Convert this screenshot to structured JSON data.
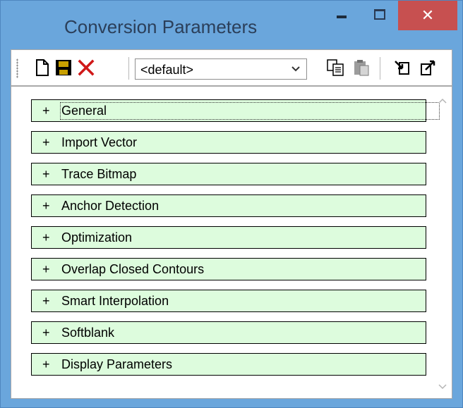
{
  "window": {
    "title": "Conversion Parameters",
    "minimize_icon": "minimize-icon",
    "maximize_icon": "maximize-icon",
    "close_label": "✕",
    "close_color": "#c75050"
  },
  "toolbar": {
    "buttons": [
      {
        "name": "new-icon"
      },
      {
        "name": "save-icon"
      },
      {
        "name": "delete-icon",
        "color": "#d01818"
      }
    ],
    "preset": {
      "value": "<default>"
    },
    "right_buttons": [
      {
        "name": "copy-icon"
      },
      {
        "name": "paste-icon"
      },
      {
        "name": "import-icon"
      },
      {
        "name": "export-icon"
      }
    ]
  },
  "sections": [
    {
      "plus": "+",
      "label": "General"
    },
    {
      "plus": "+",
      "label": "Import Vector"
    },
    {
      "plus": "+",
      "label": "Trace Bitmap"
    },
    {
      "plus": "+",
      "label": "Anchor Detection"
    },
    {
      "plus": "+",
      "label": "Optimization"
    },
    {
      "plus": "+",
      "label": "Overlap Closed Contours"
    },
    {
      "plus": "+",
      "label": "Smart Interpolation"
    },
    {
      "plus": "+",
      "label": "Softblank"
    },
    {
      "plus": "+",
      "label": "Display Parameters"
    }
  ],
  "colors": {
    "window_frame": "#6aa6dc",
    "section_bg": "#ddfcdd",
    "section_border": "#000000"
  }
}
